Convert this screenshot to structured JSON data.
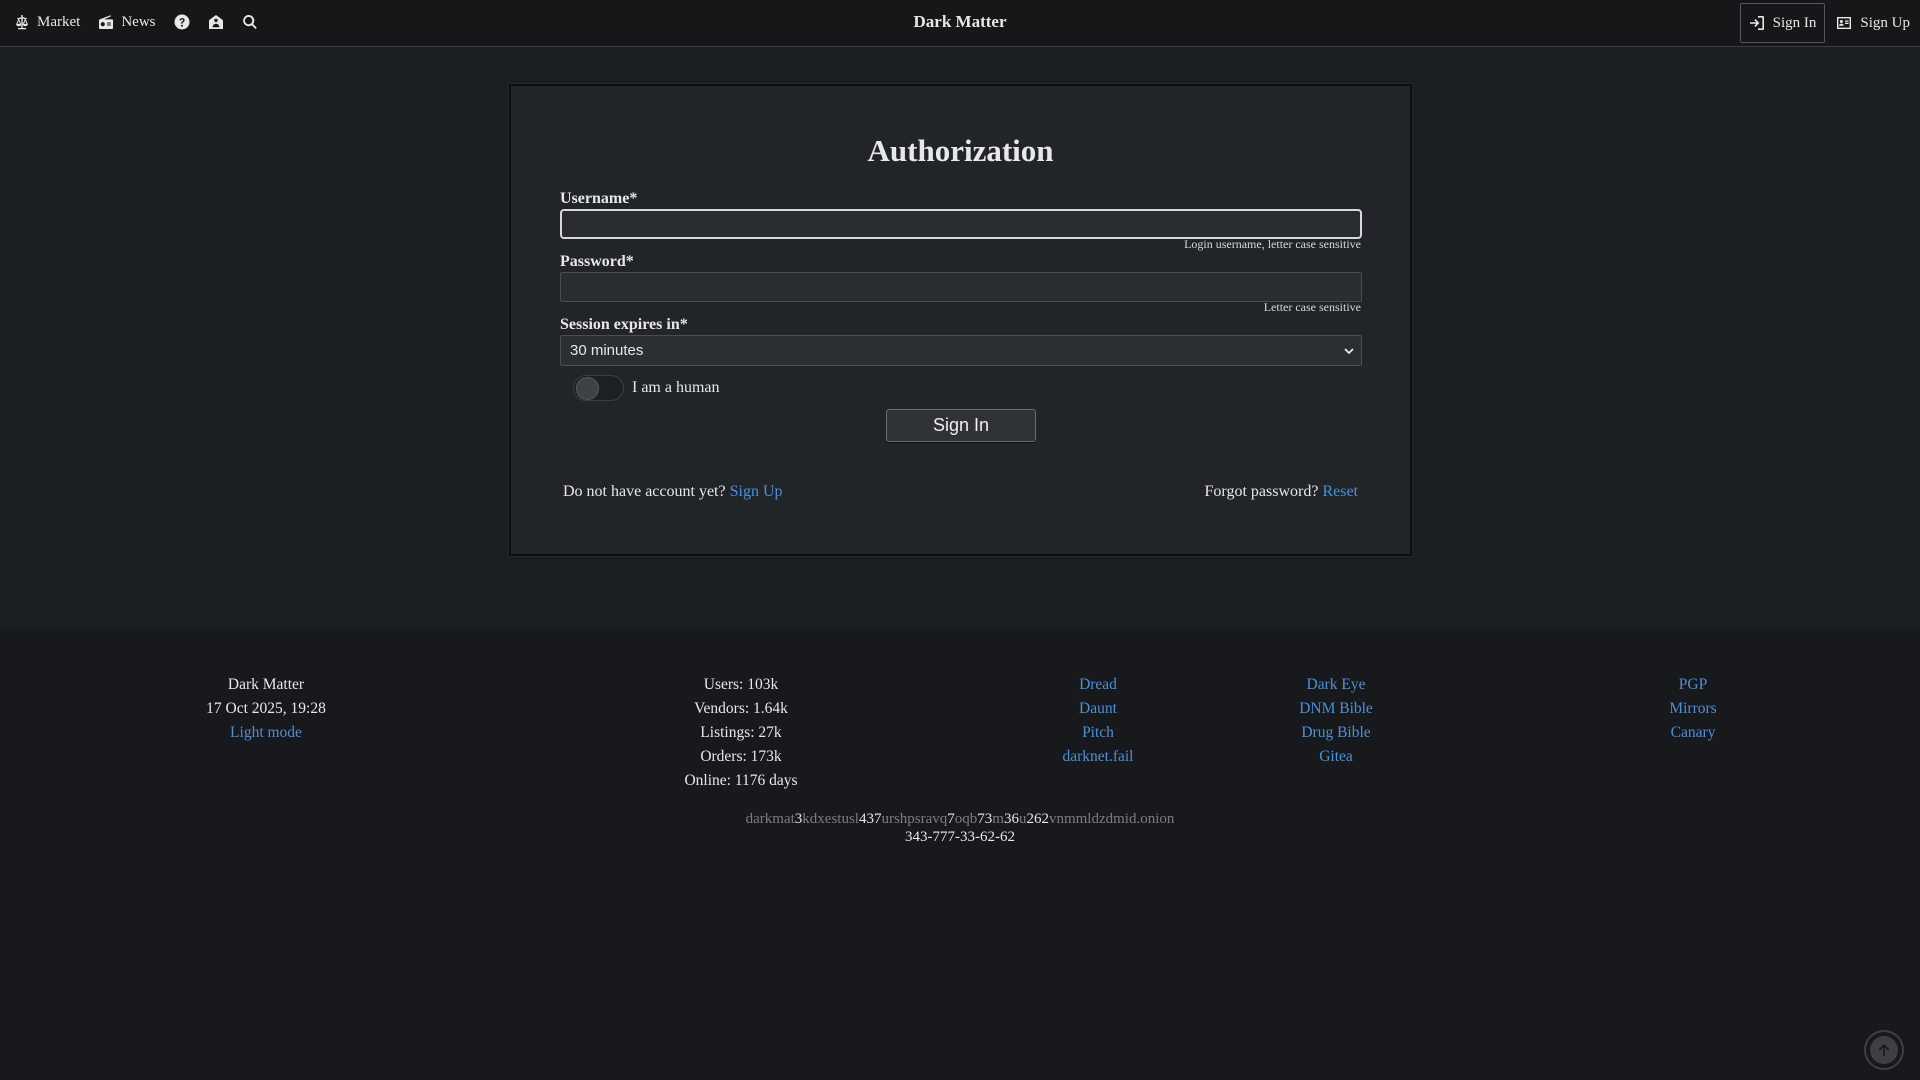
{
  "nav": {
    "market_label": "Market",
    "news_label": "News",
    "help_icon": "question-circle-icon",
    "vendor_icon": "shop-icon",
    "search_icon": "search-icon",
    "brand": "Dark Matter",
    "signin_label": "Sign In",
    "signup_label": "Sign Up"
  },
  "auth": {
    "title": "Authorization",
    "username_label": "Username*",
    "username_value": "",
    "username_hint": "Login username, letter case sensitive",
    "password_label": "Password*",
    "password_value": "",
    "password_hint": "Letter case sensitive",
    "session_label": "Session expires in*",
    "session_value": "30 minutes",
    "human_label": "I am a human",
    "human_checked": false,
    "submit_label": "Sign In",
    "no_account_text": "Do not have account yet?",
    "signup_link": "Sign Up",
    "forgot_text": "Forgot password?",
    "reset_link": "Reset"
  },
  "footer": {
    "col1": {
      "name": "Dark Matter",
      "datetime": "17 Oct 2025, 19:28",
      "light_mode": "Light mode"
    },
    "stats": {
      "users": "Users: 103k",
      "vendors": "Vendors: 1.64k",
      "listings": "Listings: 27k",
      "orders": "Orders: 173k",
      "online": "Online: 1176 days"
    },
    "links1": [
      "Dread",
      "Daunt",
      "Pitch",
      "darknet.fail"
    ],
    "links2": [
      "Dark Eye",
      "DNM Bible",
      "Drug Bible",
      "Gitea"
    ],
    "links3": [
      "PGP",
      "Mirrors",
      "Canary"
    ],
    "onion_parts": [
      {
        "t": "darkmat",
        "h": false
      },
      {
        "t": "3",
        "h": true
      },
      {
        "t": "kdxestusl",
        "h": false
      },
      {
        "t": "437",
        "h": true
      },
      {
        "t": "urshpsravq",
        "h": false
      },
      {
        "t": "7",
        "h": true
      },
      {
        "t": "oqb",
        "h": false
      },
      {
        "t": "7",
        "h": true
      },
      {
        "t": "3",
        "h": true
      },
      {
        "t": "m",
        "h": false
      },
      {
        "t": "36",
        "h": true
      },
      {
        "t": "u",
        "h": false
      },
      {
        "t": "2",
        "h": true
      },
      {
        "t": "62",
        "h": true
      },
      {
        "t": "vnmmldzdmid.onion",
        "h": false
      }
    ],
    "phone": "343-777-33-62-62"
  },
  "colors": {
    "accent_link": "#4a90d9",
    "background": "#1b1e23",
    "card": "#212428",
    "footer": "#17191c"
  }
}
